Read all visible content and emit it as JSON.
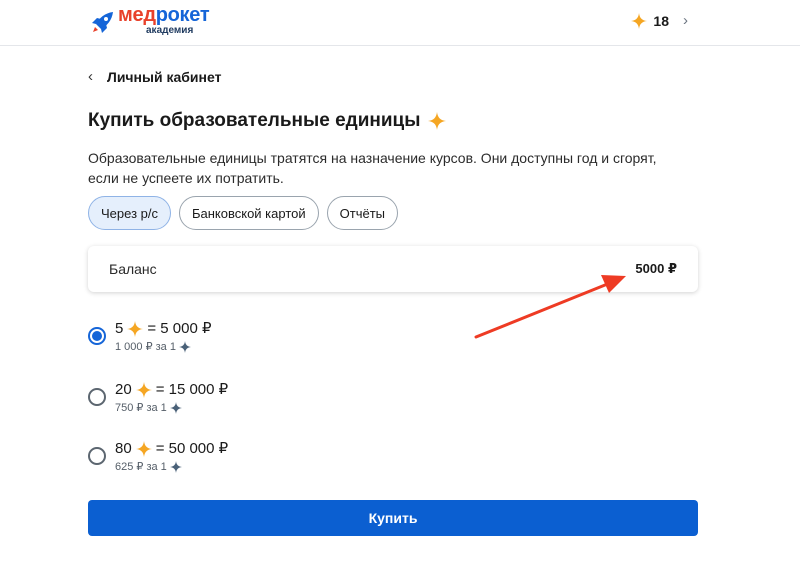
{
  "brand": {
    "name_part1": "мед",
    "name_part2": "рокет",
    "subtitle": "академия"
  },
  "header": {
    "units_count": "18",
    "star_icon": "star-icon",
    "chevron_icon": "chevron-right-icon"
  },
  "nav": {
    "back_label": "Личный кабинет"
  },
  "page": {
    "title": "Купить образовательные единицы",
    "description": "Образовательные единицы тратятся на назначение курсов. Они доступны год и сгорят, если не успеете их потратить."
  },
  "tabs": [
    {
      "label": "Через р/с",
      "active": true
    },
    {
      "label": "Банковской картой",
      "active": false
    },
    {
      "label": "Отчёты",
      "active": false
    }
  ],
  "balance": {
    "label": "Баланс",
    "amount": "5000 ₽"
  },
  "options": [
    {
      "count": "5",
      "eq": "= 5 000 ₽",
      "unit_price": "1 000 ₽ за 1",
      "selected": true
    },
    {
      "count": "20",
      "eq": "= 15 000 ₽",
      "unit_price": "750 ₽ за 1",
      "selected": false
    },
    {
      "count": "80",
      "eq": "= 50 000 ₽",
      "unit_price": "625 ₽ за 1",
      "selected": false
    }
  ],
  "actions": {
    "buy_label": "Купить"
  },
  "colors": {
    "brand_red": "#e8412b",
    "brand_blue": "#1565d8",
    "button_blue": "#0b5fd1",
    "star_gold": "#f5a623",
    "annotation_red": "#ee3b24"
  }
}
